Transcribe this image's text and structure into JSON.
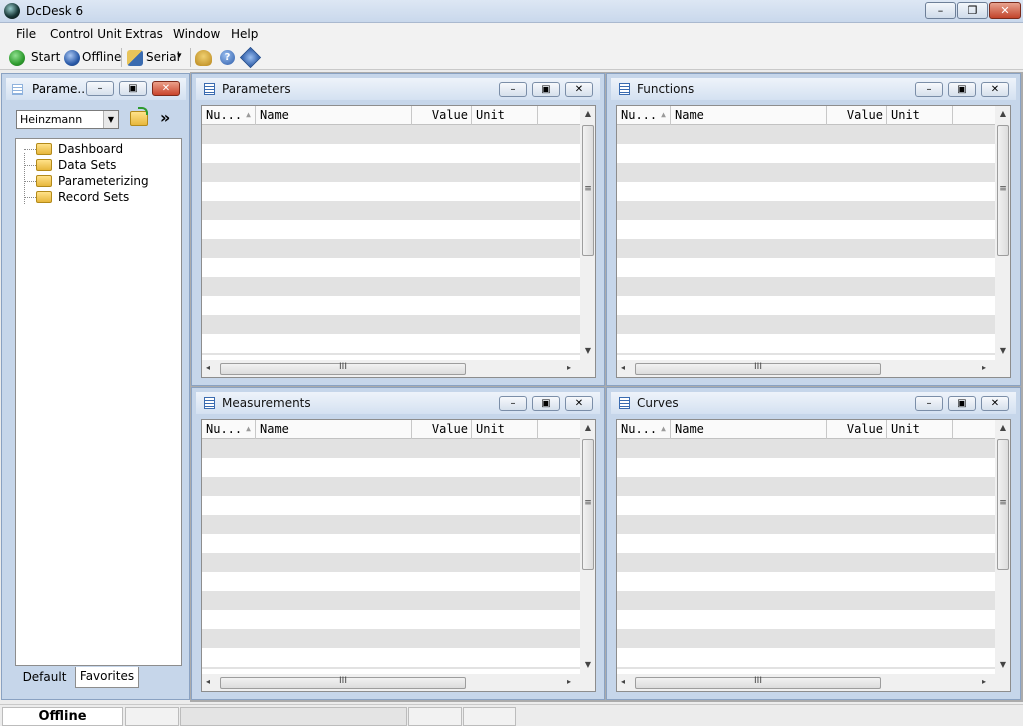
{
  "window": {
    "title": "DcDesk 6",
    "controls": {
      "minimize": "–",
      "restore": "❐",
      "close": "✕"
    }
  },
  "menu": [
    "File",
    "Control Unit",
    "Extras",
    "Window",
    "Help"
  ],
  "toolbar": {
    "start_label": "Start",
    "offline_label": "Offline",
    "serial_label": "Serial",
    "serial_arrow": "▾",
    "icons": [
      "start-icon",
      "offline-icon",
      "serial-icon",
      "config-icon",
      "help-icon",
      "info-icon"
    ],
    "colors": {
      "start": "#2e9b2e",
      "offline": "#2a5aa8",
      "help": "#2a5aa8",
      "info": "#2a5aa8"
    }
  },
  "left_panel": {
    "title": "Parame...",
    "combo_value": "Heinzmann",
    "combo_arrow": "▼",
    "open_icon": "folder-open-icon",
    "expand_glyph": "»",
    "tree": [
      "Dashboard",
      "Data Sets",
      "Parameterizing",
      "Record Sets"
    ],
    "tabs": {
      "default": "Default",
      "favorites": "Favorites"
    }
  },
  "child_windows": [
    {
      "title": "Parameters"
    },
    {
      "title": "Functions"
    },
    {
      "title": "Measurements"
    },
    {
      "title": "Curves"
    }
  ],
  "grid_columns": {
    "number": "Nu...",
    "name": "Name",
    "value": "Value",
    "unit": "Unit"
  },
  "glyphs": {
    "sort": "▲",
    "grip": "≡",
    "hgrip": "III",
    "up": "▲",
    "down": "▼",
    "left": "◂",
    "right": "▸",
    "min": "–",
    "restore": "▣",
    "close": "✕"
  },
  "status": {
    "main": "Offline"
  }
}
